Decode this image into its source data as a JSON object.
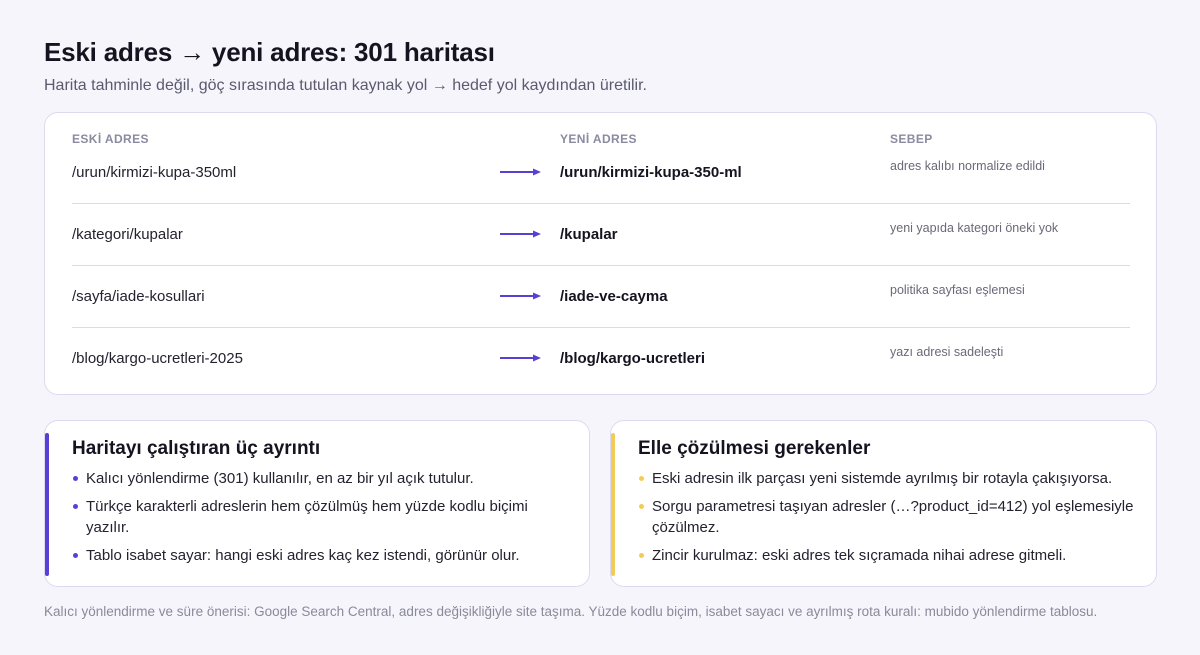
{
  "header": {
    "title": "Eski adres → yeni adres: 301 haritası",
    "subtitle": "Harita tahminle değil, göç sırasında tutulan kaynak yol → hedef yol kaydından üretilir."
  },
  "table": {
    "columns": {
      "old": "ESKİ ADRES",
      "new": "YENİ ADRES",
      "reason": "SEBEP"
    },
    "rows": [
      {
        "old": "/urun/kirmizi-kupa-350ml",
        "new": "/urun/kirmizi-kupa-350-ml",
        "reason": "adres kalıbı normalize edildi"
      },
      {
        "old": "/kategori/kupalar",
        "new": "/kupalar",
        "reason": "yeni yapıda kategori öneki yok"
      },
      {
        "old": "/sayfa/iade-kosullari",
        "new": "/iade-ve-cayma",
        "reason": "politika sayfası eşlemesi"
      },
      {
        "old": "/blog/kargo-ucretleri-2025",
        "new": "/blog/kargo-ucretleri",
        "reason": "yazı adresi sadeleşti"
      }
    ]
  },
  "notes": {
    "details": {
      "title": "Haritayı çalıştıran üç ayrıntı",
      "items": [
        "Kalıcı yönlendirme (301) kullanılır, en az bir yıl açık tutulur.",
        "Türkçe karakterli adreslerin hem çözülmüş hem yüzde kodlu biçimi yazılır.",
        "Tablo isabet sayar: hangi eski adres kaç kez istendi, görünür olur."
      ]
    },
    "manual": {
      "title": "Elle çözülmesi gerekenler",
      "items": [
        "Eski adresin ilk parçası yeni sistemde ayrılmış bir rotayla çakışıyorsa.",
        "Sorgu parametresi taşıyan adresler (…?product_id=412) yol eşlemesiyle çözülmez.",
        "Zincir kurulmaz: eski adres tek sıçramada nihai adrese gitmeli."
      ]
    }
  },
  "footer": {
    "text": "Kalıcı yönlendirme ve süre önerisi: Google Search Central, adres değişikliğiyle site taşıma. Yüzde kodlu biçim, isabet sayacı ve ayrılmış rota kuralı: mubido yönlendirme tablosu."
  },
  "colors": {
    "accent": "#5a3fd6",
    "warning": "#f3cc57",
    "background": "#f6f5fc",
    "card_border": "#dcdaf0"
  },
  "icons": {
    "row_arrow": "arrow-right-icon",
    "bullet": "bullet-dot-icon"
  }
}
